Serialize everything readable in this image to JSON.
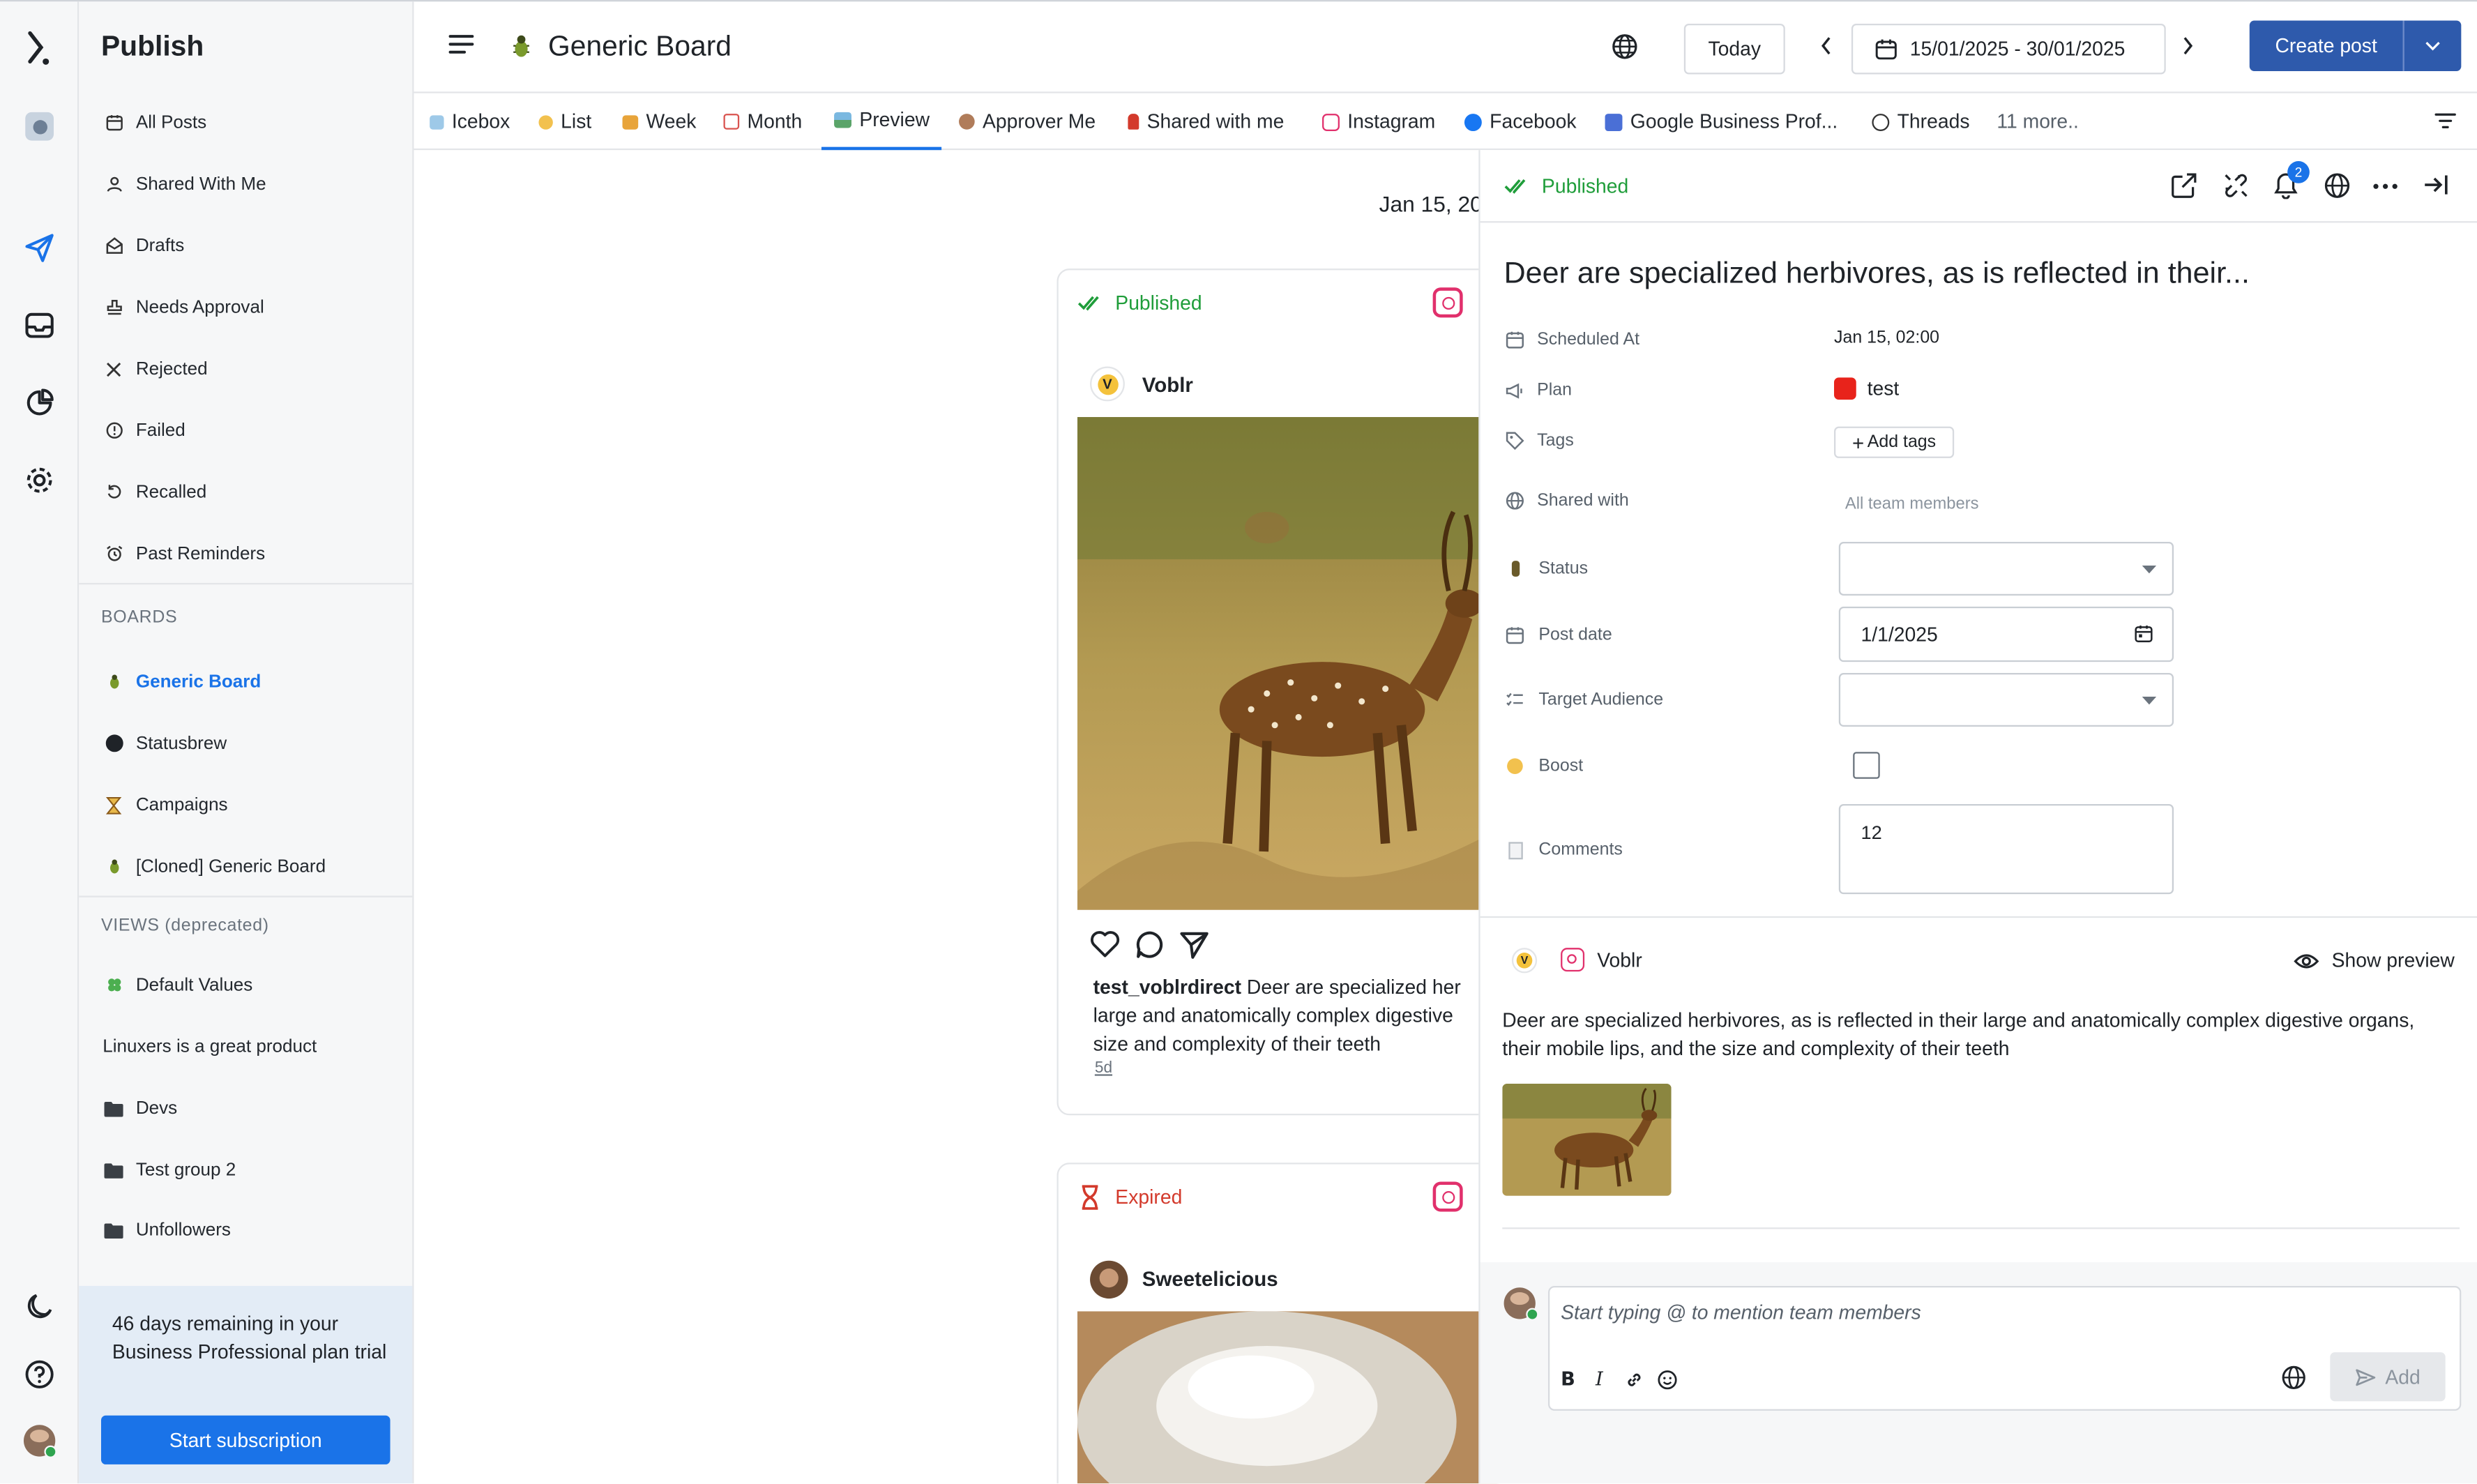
{
  "app": {
    "title": "Publish",
    "board_title": "Generic Board"
  },
  "rail": {
    "icons": [
      "logo-icon",
      "workspace-icon",
      "publish-icon",
      "inbox-icon",
      "analytics-icon",
      "settings-icon",
      "dark-mode-icon",
      "help-icon",
      "profile-avatar"
    ]
  },
  "sidebar": {
    "items": [
      {
        "label": "All Posts",
        "icon": "calendar-icon"
      },
      {
        "label": "Shared With Me",
        "icon": "user-icon"
      },
      {
        "label": "Drafts",
        "icon": "drafts-icon"
      },
      {
        "label": "Needs Approval",
        "icon": "stamp-icon"
      },
      {
        "label": "Rejected",
        "icon": "close-icon"
      },
      {
        "label": "Failed",
        "icon": "alert-icon"
      },
      {
        "label": "Recalled",
        "icon": "undo-icon"
      },
      {
        "label": "Past Reminders",
        "icon": "alarm-icon"
      }
    ],
    "boards_heading": "BOARDS",
    "boards": [
      {
        "label": "Generic Board",
        "icon": "bug-emoji",
        "active": true
      },
      {
        "label": "Statusbrew",
        "icon": "statusbrew-icon"
      },
      {
        "label": "Campaigns",
        "icon": "hourglass-emoji"
      },
      {
        "label": "[Cloned] Generic Board",
        "icon": "bug-emoji"
      }
    ],
    "views_heading": "VIEWS (deprecated)",
    "views": [
      {
        "label": "Default Values",
        "icon": "clover-emoji"
      },
      {
        "label": "Linuxers is a great product",
        "icon": ""
      },
      {
        "label": "Devs",
        "icon": "folder-icon"
      },
      {
        "label": "Test group 2",
        "icon": "folder-icon"
      },
      {
        "label": "Unfollowers",
        "icon": "folder-icon"
      }
    ],
    "trial_text": "46 days remaining in your Business Professional plan trial",
    "trial_button": "Start subscription"
  },
  "header": {
    "today_label": "Today",
    "date_range": "15/01/2025 - 30/01/2025",
    "create_post_label": "Create post"
  },
  "tabs": [
    {
      "label": "Icebox",
      "color": "#9ec9e8"
    },
    {
      "label": "List",
      "color": "#f2c14e"
    },
    {
      "label": "Week",
      "color": "#e8a43a"
    },
    {
      "label": "Month",
      "color": "#d9534f"
    },
    {
      "label": "Preview",
      "color": "#5aa469",
      "active": true
    },
    {
      "label": "Approver Me",
      "color": "#b07c5a"
    },
    {
      "label": "Shared with me",
      "color": "#d33a2c"
    },
    {
      "label": "Instagram",
      "color": "#e1306c"
    },
    {
      "label": "Facebook",
      "color": "#1877f2"
    },
    {
      "label": "Google Business Prof...",
      "color": "#4a6fd6"
    },
    {
      "label": "Threads",
      "color": "#333333"
    }
  ],
  "tabs_more": "11 more..",
  "feed": {
    "date_heading": "Jan 15, 20",
    "post1": {
      "status": "Published",
      "account": "Voblr",
      "username": "test_voblrdirect",
      "caption": "Deer are specialized her large and anatomically complex digestive size and complexity of their teeth",
      "time": "5d"
    },
    "post2": {
      "status": "Expired",
      "account": "Sweetelicious"
    }
  },
  "panel": {
    "status": "Published",
    "notification_count": "2",
    "title": "Deer are specialized herbivores, as is reflected in their...",
    "fields": {
      "scheduled_label": "Scheduled At",
      "scheduled_value": "Jan 15, 02:00",
      "plan_label": "Plan",
      "plan_value": "test",
      "plan_color": "#e8231b",
      "tags_label": "Tags",
      "tags_button": "Add tags",
      "shared_label": "Shared with",
      "shared_value": "All team members",
      "status_label": "Status",
      "status_value": "",
      "postdate_label": "Post date",
      "postdate_value": "1/1/2025",
      "audience_label": "Target Audience",
      "audience_value": "",
      "boost_label": "Boost",
      "comments_label": "Comments",
      "comments_value": "12"
    },
    "preview": {
      "account": "Voblr",
      "show_preview": "Show preview",
      "body": "Deer are specialized herbivores, as is reflected in their large and anatomically complex digestive organs, their mobile lips, and the size and complexity of their teeth"
    },
    "composer": {
      "placeholder": "Start typing @ to mention team members",
      "add_label": "Add"
    }
  },
  "colors": {
    "accent": "#1a73e8",
    "create_button": "#2e5aac",
    "published": "#1f9d3a",
    "expired": "#d33a2c",
    "instagram": "#e1306c"
  }
}
